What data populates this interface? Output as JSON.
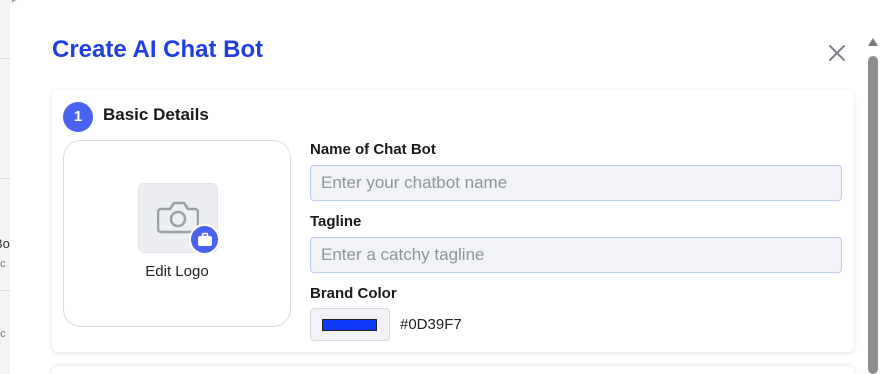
{
  "background": {
    "items": [
      {
        "title": "Bo",
        "subtitle": "pc"
      },
      {
        "title": "",
        "subtitle": "pc"
      }
    ]
  },
  "modal": {
    "title": "Create AI Chat Bot",
    "close_icon": "close-icon"
  },
  "section": {
    "step": "1",
    "title": "Basic Details"
  },
  "logo": {
    "label": "Edit Logo",
    "icon": "camera-icon",
    "badge_icon": "briefcase-icon"
  },
  "fields": {
    "name": {
      "label": "Name of Chat Bot",
      "value": "",
      "placeholder": "Enter your chatbot name"
    },
    "tagline": {
      "label": "Tagline",
      "value": "",
      "placeholder": "Enter a catchy tagline"
    },
    "brand_color": {
      "label": "Brand Color",
      "value": "#0D39F7"
    }
  },
  "colors": {
    "accent": "#4a63ef",
    "title": "#1f3fe0",
    "brand": "#0D39F7"
  }
}
